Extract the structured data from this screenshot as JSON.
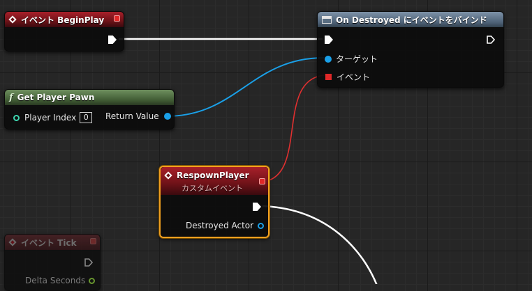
{
  "nodes": {
    "begin_play": {
      "title": "イベント BeginPlay"
    },
    "bind_destroyed": {
      "title": "On Destroyed にイベントをバインド",
      "target_label": "ターゲット",
      "event_label": "イベント"
    },
    "get_player_pawn": {
      "title": "Get Player Pawn",
      "player_index_label": "Player Index",
      "player_index_value": "0",
      "return_value_label": "Return Value"
    },
    "respawn_player": {
      "title": "RespownPlayer",
      "subtitle": "カスタムイベント",
      "destroyed_actor_label": "Destroyed Actor"
    },
    "event_tick": {
      "title": "イベント Tick",
      "delta_seconds_label": "Delta Seconds"
    }
  },
  "colors": {
    "exec_wire": "#ffffff",
    "object_wire": "#1aa0e8",
    "delegate_wire": "#e03030",
    "selection": "#f0a020"
  },
  "icons": {
    "event": "diamond-event-icon",
    "function": "function-icon",
    "bind": "window-icon"
  }
}
